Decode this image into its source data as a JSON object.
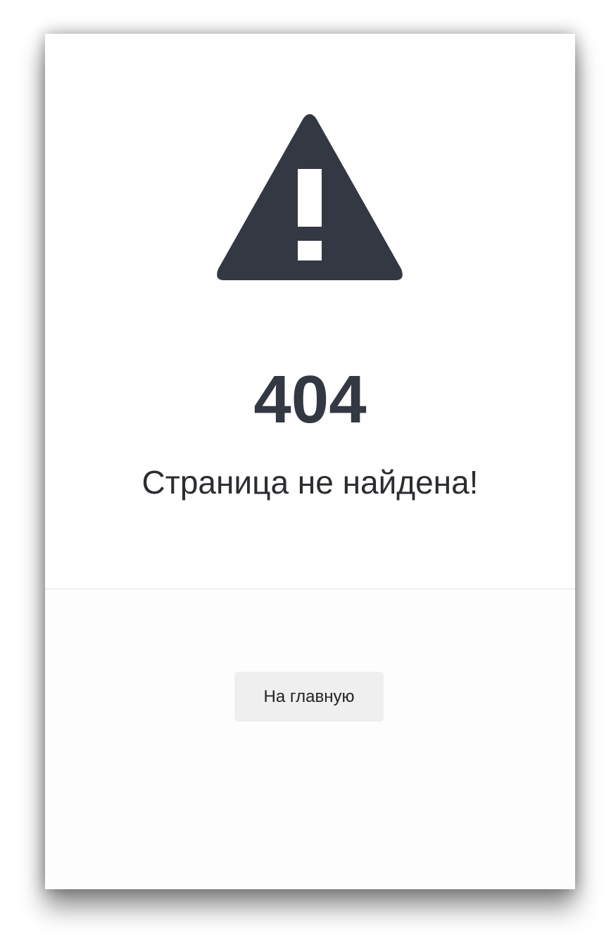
{
  "error": {
    "code": "404",
    "message": "Страница не найдена!",
    "icon": "warning-triangle-icon"
  },
  "actions": {
    "home_label": "На главную"
  },
  "colors": {
    "icon": "#333842",
    "text": "#2b2d31",
    "button_bg": "#efefef"
  }
}
